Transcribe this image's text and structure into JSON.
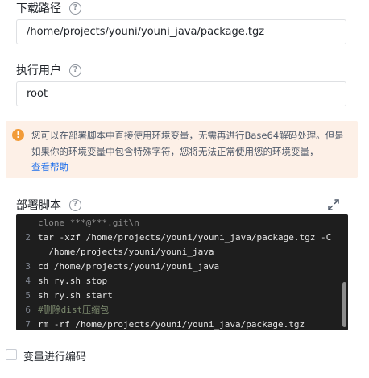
{
  "download_path": {
    "label": "下载路径",
    "value": "/home/projects/youni/youni_java/package.tgz"
  },
  "exec_user": {
    "label": "执行用户",
    "value": "root"
  },
  "notice": {
    "text": "您可以在部署脚本中直接使用环境变量，无需再进行Base64解码处理。但是如果你的环境变量中包含特殊字符，您将无法正常使用您的环境变量，",
    "link": "查看帮助"
  },
  "deploy_script": {
    "label": "部署脚本",
    "lines": [
      {
        "num": "",
        "text": "clone ***@***.git\\n",
        "style": "dim"
      },
      {
        "num": "2",
        "text": "tar -xzf /home/projects/youni/youni_java/package.tgz -C",
        "style": ""
      },
      {
        "num": "",
        "text": "  /home/projects/youni/youni_java",
        "style": ""
      },
      {
        "num": "3",
        "text": "cd /home/projects/youni/youni_java",
        "style": ""
      },
      {
        "num": "4",
        "text": "sh ry.sh stop",
        "style": ""
      },
      {
        "num": "5",
        "text": "sh ry.sh start",
        "style": ""
      },
      {
        "num": "6",
        "text": "#删除dist压缩包",
        "style": "comment"
      },
      {
        "num": "7",
        "text": "rm -rf /home/projects/youni/youni_java/package.tgz",
        "style": ""
      }
    ]
  },
  "encode_checkbox": {
    "label": "变量进行编码",
    "checked": false
  },
  "icons": {
    "help": "question-circle-icon",
    "warning": "exclamation-circle-icon",
    "expand": "expand-arrows-icon"
  },
  "colors": {
    "notice_bg": "#fdf0e7",
    "warning": "#f29b38",
    "link": "#1f6feb",
    "editor_bg": "#1e1e1e"
  }
}
